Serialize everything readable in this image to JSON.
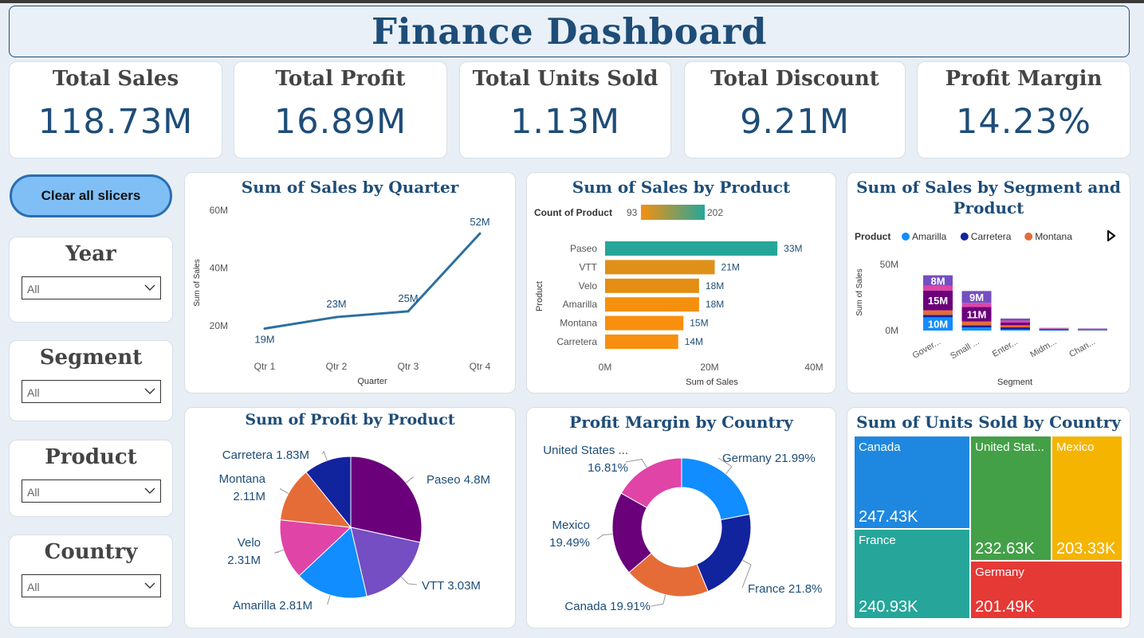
{
  "header": {
    "title": "Finance Dashboard"
  },
  "kpis": [
    {
      "label": "Total Sales",
      "value": "118.73M"
    },
    {
      "label": "Total Profit",
      "value": "16.89M"
    },
    {
      "label": "Total Units Sold",
      "value": "1.13M"
    },
    {
      "label": "Total Discount",
      "value": "9.21M"
    },
    {
      "label": "Profit Margin",
      "value": "14.23%"
    }
  ],
  "controls": {
    "clear_label": "Clear all slicers"
  },
  "slicers": [
    {
      "title": "Year",
      "value": "All"
    },
    {
      "title": "Segment",
      "value": "All"
    },
    {
      "title": "Product",
      "value": "All"
    },
    {
      "title": "Country",
      "value": "All"
    }
  ],
  "chart_data": [
    {
      "id": "quarter",
      "type": "line",
      "title": "Sum of Sales by Quarter",
      "xlabel": "Quarter",
      "ylabel": "Sum of Sales",
      "categories": [
        "Qtr 1",
        "Qtr 2",
        "Qtr 3",
        "Qtr 4"
      ],
      "values": [
        19,
        23,
        25,
        52
      ],
      "data_labels": [
        "19M",
        "23M",
        "25M",
        "52M"
      ],
      "yticks": [
        "20M",
        "40M",
        "60M"
      ],
      "ylim": [
        15,
        62
      ],
      "color": "#2c6fa0"
    },
    {
      "id": "product",
      "type": "bar",
      "orientation": "horizontal",
      "title": "Sum of Sales by Product",
      "xlabel": "Sum of Sales",
      "ylabel": "Product",
      "legend_title": "Count of Product",
      "legend_min": "93",
      "legend_max": "202",
      "categories": [
        "Paseo",
        "VTT",
        "Velo",
        "Amarilla",
        "Montana",
        "Carretera"
      ],
      "values": [
        33,
        21,
        18,
        18,
        15,
        14
      ],
      "data_labels": [
        "33M",
        "21M",
        "18M",
        "18M",
        "15M",
        "14M"
      ],
      "colors": [
        "#26a69a",
        "#df9019",
        "#e38d13",
        "#f5900f",
        "#f88f0e",
        "#f88f0e"
      ],
      "xticks": [
        "0M",
        "20M",
        "40M"
      ],
      "xlim": [
        0,
        40
      ]
    },
    {
      "id": "segment",
      "type": "bar",
      "stacked": true,
      "title": "Sum of Sales by Segment and Product",
      "xlabel": "Segment",
      "ylabel": "Sum of Sales",
      "legend_title": "Product",
      "legend": [
        {
          "name": "Amarilla",
          "color": "#118dff"
        },
        {
          "name": "Carretera",
          "color": "#12239e"
        },
        {
          "name": "Montana",
          "color": "#e66c37"
        }
      ],
      "categories": [
        "Gover...",
        "Small ...",
        "Enter...",
        "Midm...",
        "Chan..."
      ],
      "series": [
        {
          "color": "#118dff",
          "values": [
            10,
            2.3,
            0.9,
            0.3,
            0.3
          ]
        },
        {
          "color": "#12239e",
          "values": [
            1.8,
            1.6,
            1.5,
            0.3,
            0.2
          ]
        },
        {
          "color": "#e66c37",
          "values": [
            3.5,
            3.0,
            1.6,
            0.3,
            0.2
          ]
        },
        {
          "color": "#6b007b",
          "values": [
            15,
            11,
            2.0,
            0.4,
            0.3
          ]
        },
        {
          "color": "#e044a7",
          "values": [
            3.5,
            3.0,
            1.5,
            0.3,
            0.3
          ]
        },
        {
          "color": "#744ec2",
          "values": [
            8,
            9,
            1.6,
            0.4,
            0.3
          ]
        }
      ],
      "data_labels": [
        {
          "cat": 0,
          "series": 0,
          "text": "10M"
        },
        {
          "cat": 0,
          "series": 3,
          "text": "15M"
        },
        {
          "cat": 0,
          "series": 5,
          "text": "8M"
        },
        {
          "cat": 1,
          "series": 3,
          "text": "11M"
        },
        {
          "cat": 1,
          "series": 5,
          "text": "9M"
        }
      ],
      "yticks": [
        {
          "v": 0,
          "t": "0M"
        },
        {
          "v": 50,
          "t": "50M"
        }
      ],
      "ylim": [
        0,
        55
      ]
    },
    {
      "id": "profit_pie",
      "type": "pie",
      "title": "Sum of Profit by Product",
      "slices": [
        {
          "name": "Paseo",
          "value": 4.8,
          "label": "Paseo 4.8M",
          "color": "#6b007b"
        },
        {
          "name": "VTT",
          "value": 3.03,
          "label": "VTT 3.03M",
          "color": "#744ec2"
        },
        {
          "name": "Amarilla",
          "value": 2.81,
          "label": "Amarilla 2.81M",
          "color": "#118dff"
        },
        {
          "name": "Velo",
          "value": 2.31,
          "label1": "Velo",
          "label2": "2.31M",
          "color": "#e044a7"
        },
        {
          "name": "Montana",
          "value": 2.11,
          "label1": "Montana",
          "label2": "2.11M",
          "color": "#e66c37"
        },
        {
          "name": "Carretera",
          "value": 1.83,
          "label": "Carretera 1.83M",
          "color": "#12239e"
        }
      ]
    },
    {
      "id": "margin_donut",
      "type": "pie",
      "donut": true,
      "title": "Profit Margin by Country",
      "slices": [
        {
          "name": "Germany",
          "value": 21.99,
          "label": "Germany 21.99%",
          "color": "#118dff"
        },
        {
          "name": "France",
          "value": 21.8,
          "label": "France 21.8%",
          "color": "#12239e"
        },
        {
          "name": "Canada",
          "value": 19.91,
          "label": "Canada 19.91%",
          "color": "#e66c37"
        },
        {
          "name": "Mexico",
          "value": 19.49,
          "label1": "Mexico",
          "label2": "19.49%",
          "color": "#6b007b"
        },
        {
          "name": "United States",
          "value": 16.81,
          "label1": "United States ...",
          "label2": "16.81%",
          "color": "#e044a7"
        }
      ]
    },
    {
      "id": "units_treemap",
      "type": "treemap",
      "title": "Sum of Units Sold by Country",
      "cells": [
        {
          "name": "Canada",
          "value": "247.43K",
          "units": 247.43,
          "color": "#1e88e0"
        },
        {
          "name": "France",
          "value": "240.93K",
          "units": 240.93,
          "color": "#26a69a"
        },
        {
          "name": "United Stat...",
          "value": "232.63K",
          "units": 232.63,
          "color": "#43a047"
        },
        {
          "name": "Mexico",
          "value": "203.33K",
          "units": 203.33,
          "color": "#f4b400"
        },
        {
          "name": "Germany",
          "value": "201.49K",
          "units": 201.49,
          "color": "#e53935"
        }
      ]
    }
  ]
}
